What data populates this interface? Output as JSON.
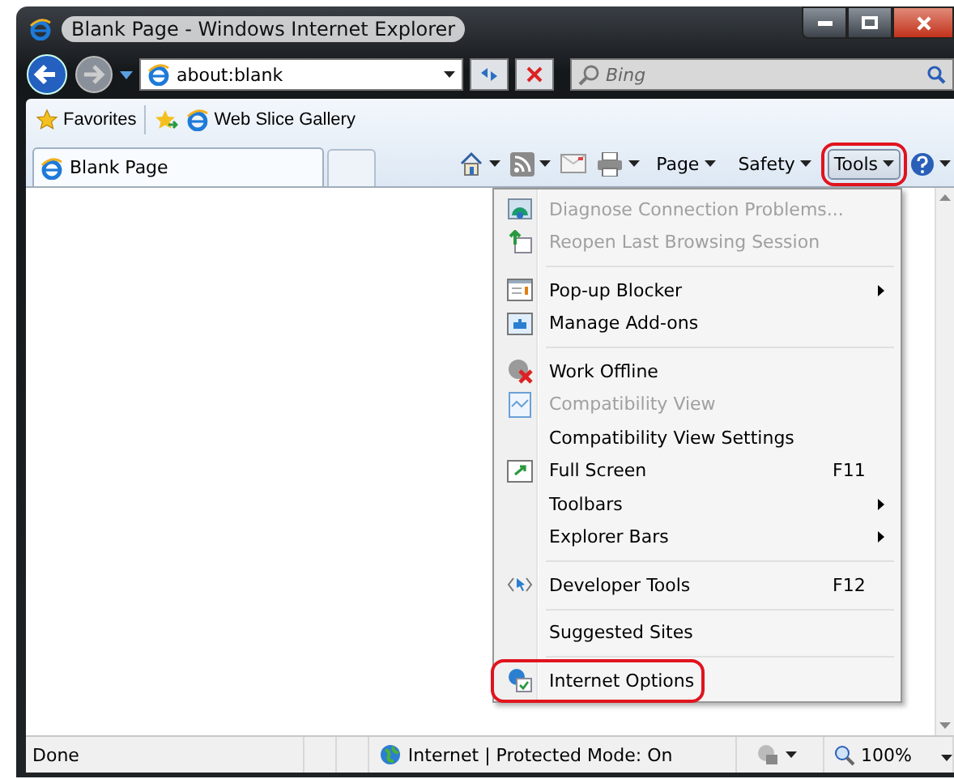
{
  "window": {
    "title": "Blank Page - Windows Internet Explorer"
  },
  "address_bar": {
    "value": "about:blank"
  },
  "search": {
    "placeholder": "Bing"
  },
  "favorites_bar": {
    "favorites": "Favorites",
    "items": [
      "Web Slice Gallery"
    ]
  },
  "tabs": [
    {
      "label": "Blank Page",
      "selected": true
    }
  ],
  "command_bar": {
    "items": [
      {
        "kind": "icon"
      },
      {
        "kind": "icon"
      },
      {
        "kind": "icon"
      },
      {
        "kind": "icon"
      },
      {
        "kind": "menu",
        "label": "Page",
        "circled": false,
        "pressed": false
      },
      {
        "kind": "menu",
        "label": "Safety",
        "circled": false,
        "pressed": false
      },
      {
        "kind": "menu",
        "label": "Tools",
        "circled": true,
        "pressed": true
      },
      {
        "kind": "icon"
      }
    ]
  },
  "tools_menu": [
    {
      "kind": "item",
      "label": "Diagnose Connection Problems...",
      "disabled": true,
      "circled": false
    },
    {
      "kind": "item",
      "label": "Reopen Last Browsing Session",
      "disabled": true,
      "circled": false
    },
    {
      "kind": "separator"
    },
    {
      "kind": "item",
      "label": "Pop-up Blocker",
      "disabled": false,
      "submenu": true,
      "circled": false
    },
    {
      "kind": "item",
      "label": "Manage Add-ons",
      "disabled": false,
      "circled": false
    },
    {
      "kind": "separator"
    },
    {
      "kind": "item",
      "label": "Work Offline",
      "disabled": false,
      "circled": false
    },
    {
      "kind": "item",
      "label": "Compatibility View",
      "disabled": true,
      "circled": false
    },
    {
      "kind": "item",
      "label": "Compatibility View Settings",
      "disabled": false,
      "circled": false
    },
    {
      "kind": "item",
      "label": "Full Screen",
      "shortcut": "F11",
      "disabled": false,
      "circled": false
    },
    {
      "kind": "item",
      "label": "Toolbars",
      "disabled": false,
      "submenu": true,
      "circled": false
    },
    {
      "kind": "item",
      "label": "Explorer Bars",
      "disabled": false,
      "submenu": true,
      "circled": false
    },
    {
      "kind": "separator"
    },
    {
      "kind": "item",
      "label": "Developer Tools",
      "shortcut": "F12",
      "disabled": false,
      "circled": false
    },
    {
      "kind": "separator"
    },
    {
      "kind": "item",
      "label": "Suggested Sites",
      "disabled": false,
      "circled": false
    },
    {
      "kind": "separator"
    },
    {
      "kind": "item",
      "label": "Internet Options",
      "disabled": false,
      "circled": true
    }
  ],
  "status_bar": {
    "status": "Done",
    "zone": "Internet | Protected Mode: On",
    "zoom": "100%"
  }
}
